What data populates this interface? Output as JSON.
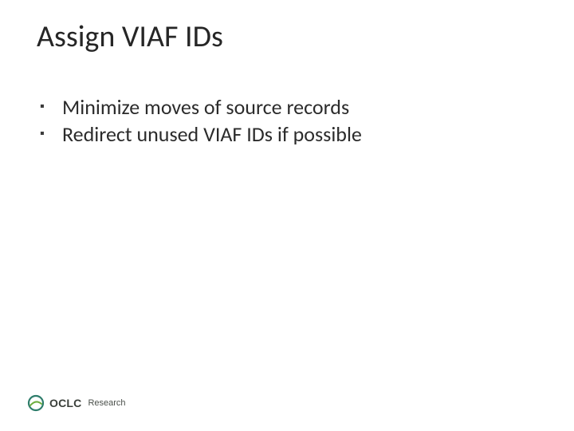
{
  "slide": {
    "title": "Assign VIAF IDs",
    "bullets": [
      "Minimize moves of source records",
      "Redirect unused VIAF IDs if possible"
    ]
  },
  "footer": {
    "logo_main": "OCLC",
    "logo_sub": "Research"
  }
}
